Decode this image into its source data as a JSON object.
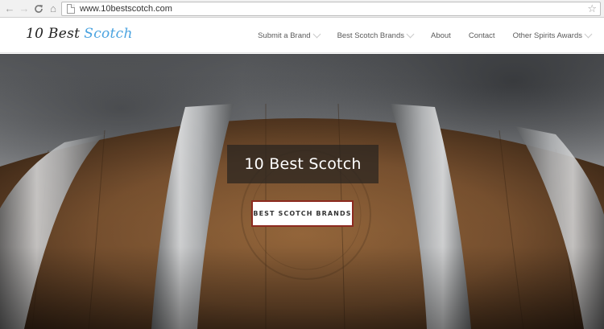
{
  "browser": {
    "back_icon": "←",
    "forward_icon": "→",
    "reload_icon": "C",
    "home_icon": "⌂",
    "url": "www.10bestscotch.com",
    "bookmark_icon": "☆"
  },
  "site": {
    "logo_main": "10 Best",
    "logo_accent": "Scotch",
    "accent_color": "#4aa3e0",
    "menu": [
      {
        "label": "Submit a Brand",
        "has_dropdown": true
      },
      {
        "label": "Best Scotch Brands",
        "has_dropdown": true
      },
      {
        "label": "About",
        "has_dropdown": false
      },
      {
        "label": "Contact",
        "has_dropdown": false
      },
      {
        "label": "Other Spirits Awards",
        "has_dropdown": true
      }
    ]
  },
  "hero": {
    "title": "10 Best Scotch",
    "button_label": "BEST SCOTCH BRANDS",
    "button_border_color": "#8c2a1f"
  }
}
